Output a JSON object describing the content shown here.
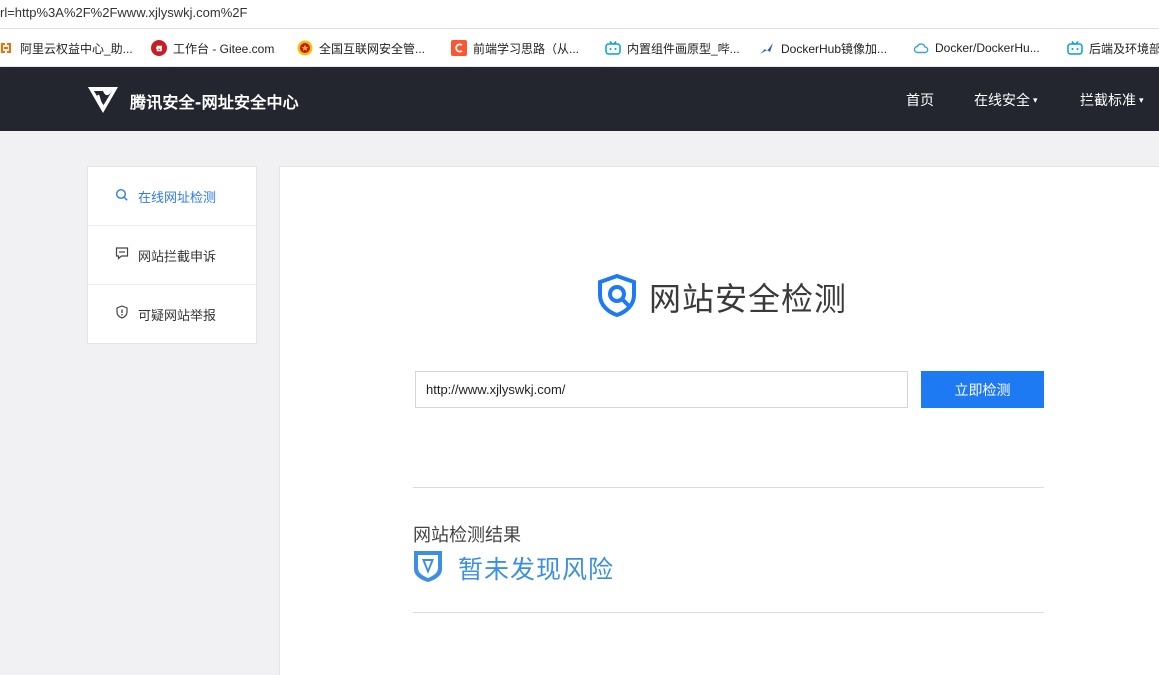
{
  "browser": {
    "address": "rl=http%3A%2F%2Fwww.xjlyswkj.com%2F",
    "bookmarks": [
      {
        "label": "阿里云权益中心_助...",
        "icon": "aliyun-icon",
        "color": "#ff6a00"
      },
      {
        "label": "工作台 - Gitee.com",
        "icon": "gitee-icon",
        "color": "#c71d23"
      },
      {
        "label": "全国互联网安全管...",
        "icon": "police-badge-icon",
        "color": "#c8102e"
      },
      {
        "label": "前端学习思路（从...",
        "icon": "csdn-icon",
        "color": "#fc5531"
      },
      {
        "label": "内置组件画原型_哔...",
        "icon": "bilibili-icon",
        "color": "#00a1d6"
      },
      {
        "label": "DockerHub镜像加...",
        "icon": "docker-hub-icon",
        "color": "#2f5fb3"
      },
      {
        "label": "Docker/DockerHu...",
        "icon": "cloud-icon",
        "color": "#3aa0e6"
      },
      {
        "label": "后端及环境部",
        "icon": "bilibili-icon",
        "color": "#00a1d6"
      }
    ]
  },
  "header": {
    "brand": "腾讯安全-网址安全中心",
    "nav": [
      {
        "label": "首页",
        "dropdown": false
      },
      {
        "label": "在线安全",
        "dropdown": true
      },
      {
        "label": "拦截标准",
        "dropdown": true
      }
    ],
    "caret": "▾"
  },
  "sidebar": {
    "items": [
      {
        "label": "在线网址检测",
        "icon": "search-icon",
        "active": true
      },
      {
        "label": "网站拦截申诉",
        "icon": "message-icon",
        "active": false
      },
      {
        "label": "可疑网站举报",
        "icon": "shield-alert-icon",
        "active": false
      }
    ]
  },
  "main": {
    "title": "网站安全检测",
    "url_value": "http://www.xjlyswkj.com/",
    "check_button": "立即检测",
    "result_label": "网站检测结果",
    "result_status": "暂未发现风险"
  },
  "colors": {
    "accent": "#1d7af3",
    "nav_bg": "#23252f",
    "result_text": "#3c8fe4",
    "active_side": "#2e7be6"
  }
}
